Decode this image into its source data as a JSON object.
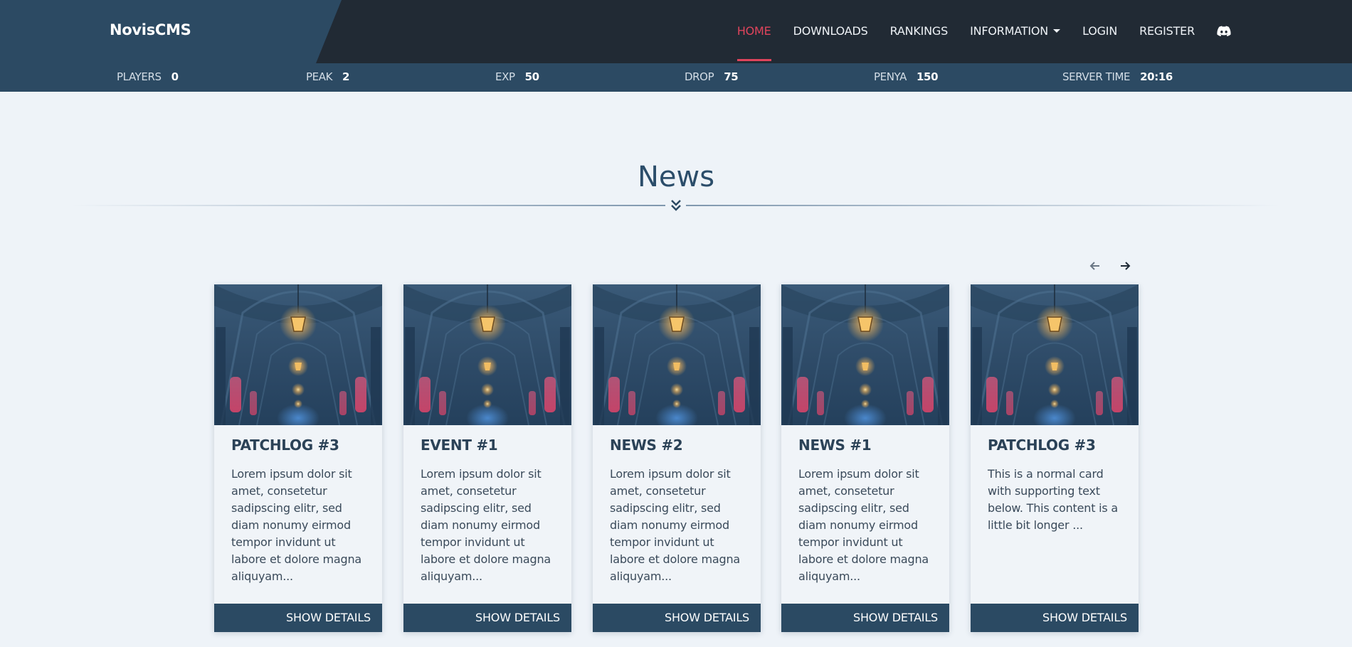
{
  "brand": "NovisCMS",
  "nav": {
    "home": "HOME",
    "downloads": "DOWNLOADS",
    "rankings": "RANKINGS",
    "information": "INFORMATION",
    "login": "LOGIN",
    "register": "REGISTER",
    "discord_icon": "discord-icon"
  },
  "stats": [
    {
      "label": "PLAYERS",
      "value": "0"
    },
    {
      "label": "PEAK",
      "value": "2"
    },
    {
      "label": "EXP",
      "value": "50"
    },
    {
      "label": "DROP",
      "value": "75"
    },
    {
      "label": "PENYA",
      "value": "150"
    },
    {
      "label": "SERVER TIME",
      "value": "20:16"
    }
  ],
  "section": {
    "title": "News"
  },
  "cards": [
    {
      "title": "PATCHLOG #3",
      "text": "Lorem ipsum dolor sit amet, consetetur sadipscing elitr, sed diam nonumy eirmod tempor invidunt ut labore et dolore magna aliquyam...",
      "button": "SHOW DETAILS"
    },
    {
      "title": "EVENT #1",
      "text": "Lorem ipsum dolor sit amet, consetetur sadipscing elitr, sed diam nonumy eirmod tempor invidunt ut labore et dolore magna aliquyam...",
      "button": "SHOW DETAILS"
    },
    {
      "title": "NEWS #2",
      "text": "Lorem ipsum dolor sit amet, consetetur sadipscing elitr, sed diam nonumy eirmod tempor invidunt ut labore et dolore magna aliquyam...",
      "button": "SHOW DETAILS"
    },
    {
      "title": "NEWS #1",
      "text": "Lorem ipsum dolor sit amet, consetetur sadipscing elitr, sed diam nonumy eirmod tempor invidunt ut labore et dolore magna aliquyam...",
      "button": "SHOW DETAILS"
    },
    {
      "title": "PATCHLOG #3",
      "text": "This is a normal card with supporting text below. This content is a little bit longer ...",
      "button": "SHOW DETAILS"
    }
  ],
  "colors": {
    "accent": "#e0445c",
    "navbar": "#212a34",
    "brand_panel": "#2c4a63",
    "card_button": "#2b4a63",
    "page_bg": "#eef3f8"
  }
}
